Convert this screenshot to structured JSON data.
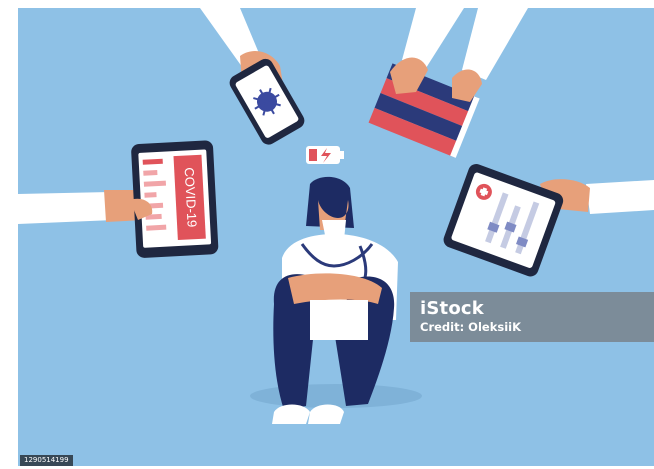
{
  "illustration": {
    "background_color": "#8ec1e6",
    "tablet_screen_text": "COVID-19"
  },
  "watermark": {
    "brand": "iStock",
    "credit": "Credit: OleksiiK"
  },
  "image_id": "1290514199",
  "colors": {
    "accent_red": "#e0535a",
    "navy": "#1d2b63",
    "skin": "#e7a07a",
    "coat_white": "#ffffff"
  }
}
